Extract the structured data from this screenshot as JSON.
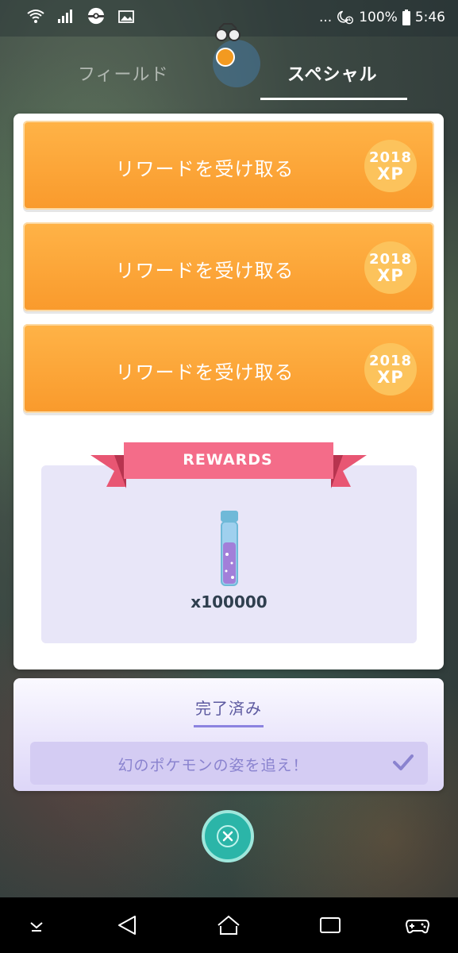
{
  "status_bar": {
    "left_icons": [
      "wifi-icon",
      "signal-icon",
      "pokeball-icon",
      "gallery-icon"
    ],
    "dots": "...",
    "battery": "100%",
    "time": "5:46"
  },
  "tabs": [
    {
      "label": "フィールド",
      "active": false
    },
    {
      "label": "スペシャル",
      "active": true
    }
  ],
  "reward_buttons": [
    {
      "label": "リワードを受け取る",
      "xp_value": "2018",
      "xp_unit": "XP"
    },
    {
      "label": "リワードを受け取る",
      "xp_value": "2018",
      "xp_unit": "XP"
    },
    {
      "label": "リワードを受け取る",
      "xp_value": "2018",
      "xp_unit": "XP"
    }
  ],
  "rewards": {
    "title": "REWARDS",
    "item_icon": "stardust-bottle-icon",
    "quantity": "x100000"
  },
  "completed": {
    "title": "完了済み",
    "tasks": [
      {
        "label": "幻のポケモンの姿を追え！",
        "checked": true
      }
    ]
  },
  "close_button": {
    "icon": "close-icon"
  },
  "nav_bar": [
    "down-chevron-icon",
    "back-icon",
    "home-icon",
    "recents-icon",
    "game-controller-icon"
  ],
  "colors": {
    "orange": "#f99a2c",
    "ribbon": "#f16a86",
    "panel": "#e8e6f8",
    "teal": "#2bb5a8",
    "purple_text": "#5d5aa0"
  }
}
